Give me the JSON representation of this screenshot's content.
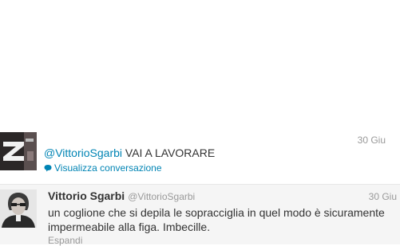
{
  "tweet_reply": {
    "timestamp": "30 Giu",
    "mention": "@VittorioSgarbi",
    "text": " VAI A LAVORARE",
    "conversation_link": "Visualizza conversazione"
  },
  "tweet_original": {
    "fullname": "Vittorio Sgarbi",
    "username": "@VittorioSgarbi",
    "timestamp": "30 Giu",
    "text": "un coglione che si depila le sopracciglia in quel modo è sicuramente impermeabile alla figa. Imbecille.",
    "expand_link": "Espandi"
  },
  "colors": {
    "link": "#0084b4",
    "muted": "#999999",
    "text": "#333333"
  },
  "icons": {
    "conversation": "speech-bubble-icon"
  }
}
